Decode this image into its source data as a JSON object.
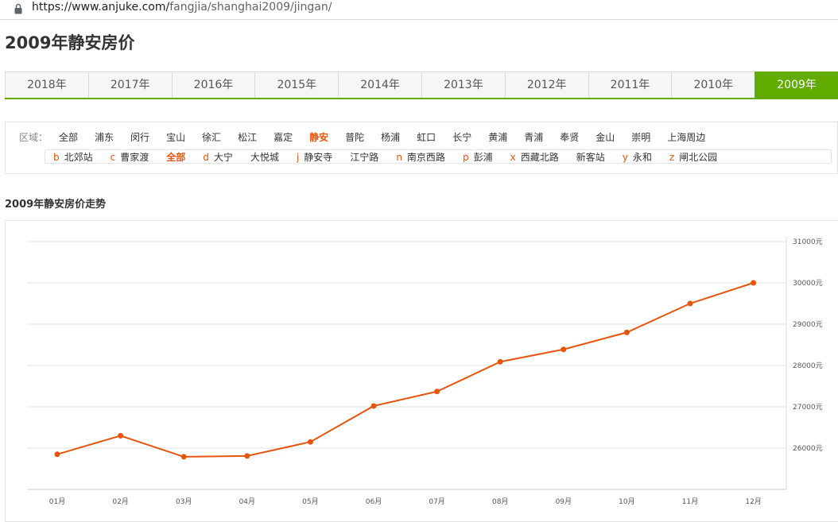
{
  "browser": {
    "url_prefix": "https://www.anjuke.com/",
    "url_rest": "fangjia/shanghai2009/jingan/"
  },
  "page": {
    "title": "2009年静安房价"
  },
  "year_tabs": [
    {
      "label": "2018年",
      "active": false
    },
    {
      "label": "2017年",
      "active": false
    },
    {
      "label": "2016年",
      "active": false
    },
    {
      "label": "2015年",
      "active": false
    },
    {
      "label": "2014年",
      "active": false
    },
    {
      "label": "2013年",
      "active": false
    },
    {
      "label": "2012年",
      "active": false
    },
    {
      "label": "2011年",
      "active": false
    },
    {
      "label": "2010年",
      "active": false
    },
    {
      "label": "2009年",
      "active": true
    }
  ],
  "filters": {
    "region_label": "区域：",
    "regions": [
      {
        "label": "全部",
        "active": false
      },
      {
        "label": "浦东",
        "active": false
      },
      {
        "label": "闵行",
        "active": false
      },
      {
        "label": "宝山",
        "active": false
      },
      {
        "label": "徐汇",
        "active": false
      },
      {
        "label": "松江",
        "active": false
      },
      {
        "label": "嘉定",
        "active": false
      },
      {
        "label": "静安",
        "active": true
      },
      {
        "label": "普陀",
        "active": false
      },
      {
        "label": "杨浦",
        "active": false
      },
      {
        "label": "虹口",
        "active": false
      },
      {
        "label": "长宁",
        "active": false
      },
      {
        "label": "黄浦",
        "active": false
      },
      {
        "label": "青浦",
        "active": false
      },
      {
        "label": "奉贤",
        "active": false
      },
      {
        "label": "金山",
        "active": false
      },
      {
        "label": "崇明",
        "active": false
      },
      {
        "label": "上海周边",
        "active": false
      }
    ],
    "subareas": [
      {
        "letter": "b",
        "label": "北郊站",
        "active": false
      },
      {
        "letter": "c",
        "label": "曹家渡",
        "active": false
      },
      {
        "letter": "",
        "label": "全部",
        "active": true
      },
      {
        "letter": "d",
        "label": "大宁",
        "active": false
      },
      {
        "letter": "",
        "label": "大悦城",
        "active": false
      },
      {
        "letter": "j",
        "label": "静安寺",
        "active": false
      },
      {
        "letter": "",
        "label": "江宁路",
        "active": false
      },
      {
        "letter": "n",
        "label": "南京西路",
        "active": false
      },
      {
        "letter": "p",
        "label": "彭浦",
        "active": false
      },
      {
        "letter": "x",
        "label": "西藏北路",
        "active": false
      },
      {
        "letter": "",
        "label": "新客站",
        "active": false
      },
      {
        "letter": "y",
        "label": "永和",
        "active": false
      },
      {
        "letter": "z",
        "label": "闸北公园",
        "active": false
      }
    ]
  },
  "chart_heading": "2009年静安房价走势",
  "colors": {
    "accent_green": "#62ab00",
    "line_orange": "#e6550d",
    "grid": "#e0e0e0"
  },
  "chart_data": {
    "type": "line",
    "categories": [
      "01月",
      "02月",
      "03月",
      "04月",
      "05月",
      "06月",
      "07月",
      "08月",
      "09月",
      "10月",
      "11月",
      "12月"
    ],
    "series": [
      {
        "values": [
          25850,
          26300,
          25790,
          25810,
          26150,
          27020,
          27370,
          28090,
          28390,
          28800,
          29500,
          30000
        ]
      }
    ],
    "y_ticks": [
      "26000元",
      "27000元",
      "28000元",
      "29000元",
      "30000元",
      "31000元"
    ],
    "ylim": [
      25000,
      31000
    ],
    "y_axis_position": "right",
    "grid": true,
    "legend": "none"
  }
}
